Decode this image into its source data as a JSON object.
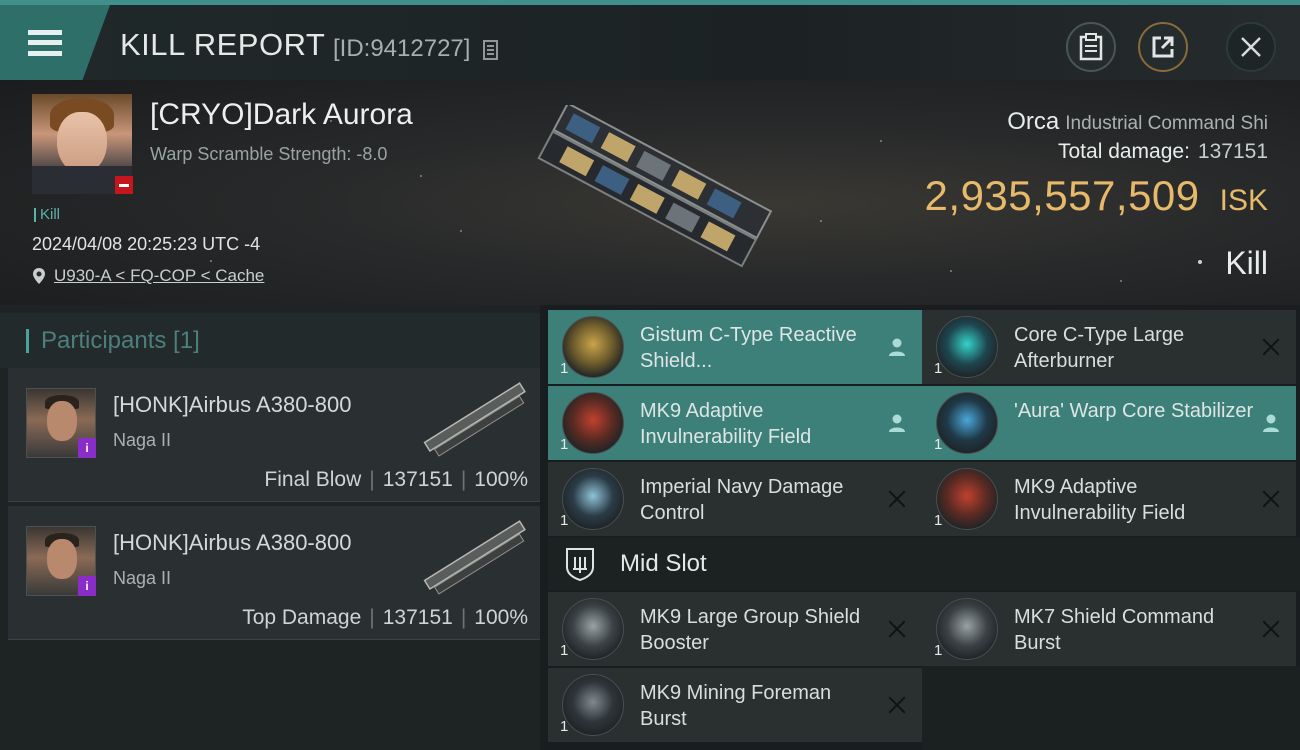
{
  "header": {
    "title": "KILL REPORT",
    "id_text": "[ID:9412727]"
  },
  "victim": {
    "name": "[CRYO]Dark Aurora",
    "subtitle": "Warp Scramble Strength: -8.0",
    "tag": "Kill",
    "datetime": "2024/04/08 20:25:23 UTC -4",
    "location": "U930-A < FQ-COP < Cache",
    "ship": "Orca",
    "ship_class": "Industrial Command Shi",
    "total_damage_label": "Total damage:",
    "total_damage": "137151",
    "isk_value": "2,935,557,509",
    "isk_unit": "ISK",
    "result": "Kill"
  },
  "participants": {
    "title": "Participants [1]",
    "rows": [
      {
        "name": "[HONK]Airbus A380-800",
        "ship": "Naga II",
        "role": "Final Blow",
        "damage": "137151",
        "percent": "100%"
      },
      {
        "name": "[HONK]Airbus A380-800",
        "ship": "Naga II",
        "role": "Top Damage",
        "damage": "137151",
        "percent": "100%"
      }
    ]
  },
  "modules": {
    "high": [
      {
        "qty": "1",
        "name": "Gistum C-Type Reactive Shield...",
        "highlight": true,
        "action": "person-icon"
      },
      {
        "qty": "1",
        "name": "Core C-Type Large Afterburner",
        "highlight": false,
        "action": "close-icon"
      },
      {
        "qty": "1",
        "name": "MK9 Adaptive Invulnerability Field",
        "highlight": true,
        "action": "person-icon"
      },
      {
        "qty": "1",
        "name": "'Aura' Warp Core Stabilizer",
        "highlight": true,
        "action": "person-icon"
      },
      {
        "qty": "1",
        "name": "Imperial Navy Damage Control",
        "highlight": false,
        "action": "close-icon"
      },
      {
        "qty": "1",
        "name": "MK9 Adaptive Invulnerability Field",
        "highlight": false,
        "action": "close-icon"
      }
    ],
    "mid_slot_label": "Mid Slot",
    "mid": [
      {
        "qty": "1",
        "name": "MK9 Large Group Shield Booster",
        "highlight": false,
        "action": "close-icon"
      },
      {
        "qty": "1",
        "name": "MK7 Shield Command Burst",
        "highlight": false,
        "action": "close-icon"
      },
      {
        "qty": "1",
        "name": "MK9 Mining Foreman Burst",
        "highlight": false,
        "action": "close-icon"
      }
    ]
  },
  "colors": {
    "accent": "#3d7f79",
    "isk": "#e7b96a",
    "badge_red": "#c4161c",
    "badge_purple": "#8a2cc7"
  }
}
